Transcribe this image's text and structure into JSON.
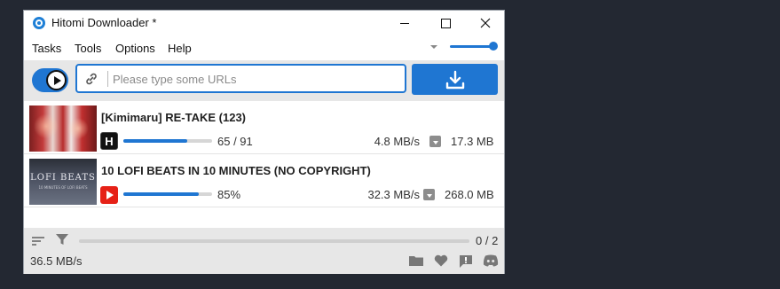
{
  "window": {
    "title": "Hitomi Downloader *"
  },
  "colors": {
    "accent": "#1f76d2",
    "toolbar_bg": "#e7e7e7",
    "desktop_bg": "#232832"
  },
  "menu": {
    "tasks": "Tasks",
    "tools": "Tools",
    "options": "Options",
    "help": "Help"
  },
  "volume_slider": {
    "level_percent": 100
  },
  "toolbar": {
    "toggle_state": "on",
    "url_placeholder": "Please type some URLs",
    "url_value": "",
    "download_icon": "download-icon"
  },
  "tasks": [
    {
      "title": "[Kimimaru] RE-TAKE (123)",
      "site_icon": "hitomi-h-icon",
      "site_letter": "H",
      "progress_fraction": 0.72,
      "progress_text": "65 / 91",
      "speed": "4.8 MB/s",
      "size": "17.3 MB"
    },
    {
      "title": "10 LOFI BEATS IN 10 MINUTES (NO COPYRIGHT)",
      "site_icon": "youtube-icon",
      "thumb_text": "LOFI BEATS",
      "thumb_subtext": "10 MINUTES OF LOFI BEATS",
      "progress_fraction": 0.85,
      "progress_text": "85%",
      "speed": "32.3 MB/s",
      "size": "268.0 MB"
    }
  ],
  "status": {
    "overall_count": "0 / 2",
    "overall_fraction": 0,
    "total_speed": "36.5 MB/s"
  }
}
